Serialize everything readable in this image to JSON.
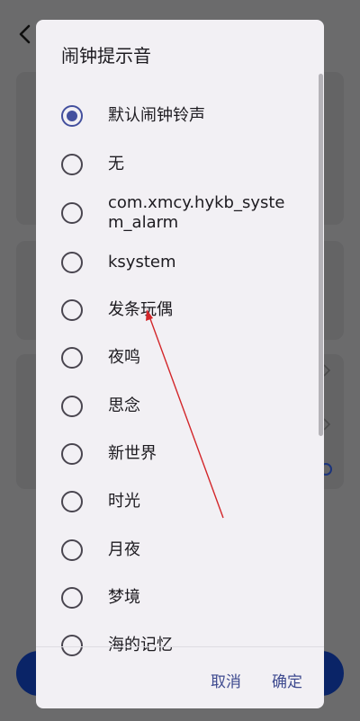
{
  "dialog": {
    "title": "闹钟提示音",
    "options": [
      {
        "label": "默认闹钟铃声",
        "selected": true
      },
      {
        "label": "无",
        "selected": false
      },
      {
        "label": "com.xmcy.hykb_system_alarm",
        "selected": false
      },
      {
        "label": "ksystem",
        "selected": false
      },
      {
        "label": "发条玩偶",
        "selected": false
      },
      {
        "label": "夜鸣",
        "selected": false
      },
      {
        "label": "思念",
        "selected": false
      },
      {
        "label": "新世界",
        "selected": false
      },
      {
        "label": "时光",
        "selected": false
      },
      {
        "label": "月夜",
        "selected": false
      },
      {
        "label": "梦境",
        "selected": false
      },
      {
        "label": "海的记忆",
        "selected": false
      }
    ],
    "cancel_label": "取消",
    "confirm_label": "确定"
  },
  "colors": {
    "accent": "#44509e",
    "annotation_arrow": "#d3262a",
    "dialog_bg": "#f2f0f4",
    "bottom_button": "#0c2a76"
  },
  "icons": {
    "back": "chevron-left-icon",
    "selected": "radio-checked-icon",
    "unselected": "radio-unchecked-icon"
  }
}
